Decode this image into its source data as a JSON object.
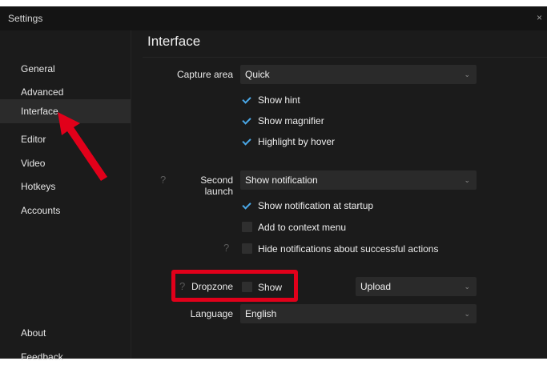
{
  "window": {
    "title": "Settings",
    "close_glyph": "×"
  },
  "sidebar": {
    "items": [
      {
        "label": "General",
        "active": false
      },
      {
        "label": "Advanced",
        "active": false
      },
      {
        "label": "Interface",
        "active": true
      },
      {
        "label": "Editor",
        "active": false
      },
      {
        "label": "Video",
        "active": false
      },
      {
        "label": "Hotkeys",
        "active": false
      },
      {
        "label": "Accounts",
        "active": false
      }
    ],
    "bottom_items": [
      {
        "label": "About"
      },
      {
        "label": "Feedback"
      }
    ]
  },
  "content": {
    "heading": "Interface",
    "capture_area": {
      "label": "Capture area",
      "value": "Quick",
      "options": [
        {
          "label": "Show hint",
          "checked": true
        },
        {
          "label": "Show magnifier",
          "checked": true
        },
        {
          "label": "Highlight by hover",
          "checked": true
        }
      ]
    },
    "second_launch": {
      "help": "?",
      "label": "Second launch",
      "value": "Show notification",
      "options": [
        {
          "label": "Show notification at startup",
          "checked": true
        },
        {
          "label": "Add to context menu",
          "checked": false
        },
        {
          "label": "Hide notifications about successful actions",
          "checked": false
        }
      ],
      "options_help": "?"
    },
    "dropzone": {
      "help": "?",
      "label": "Dropzone",
      "show_label": "Show",
      "show_checked": false,
      "action_value": "Upload"
    },
    "language": {
      "label": "Language",
      "value": "English"
    }
  },
  "icons": {
    "chevron": "⌄"
  },
  "annotation_color": "#e1001a",
  "accent_color": "#4aa8e8"
}
